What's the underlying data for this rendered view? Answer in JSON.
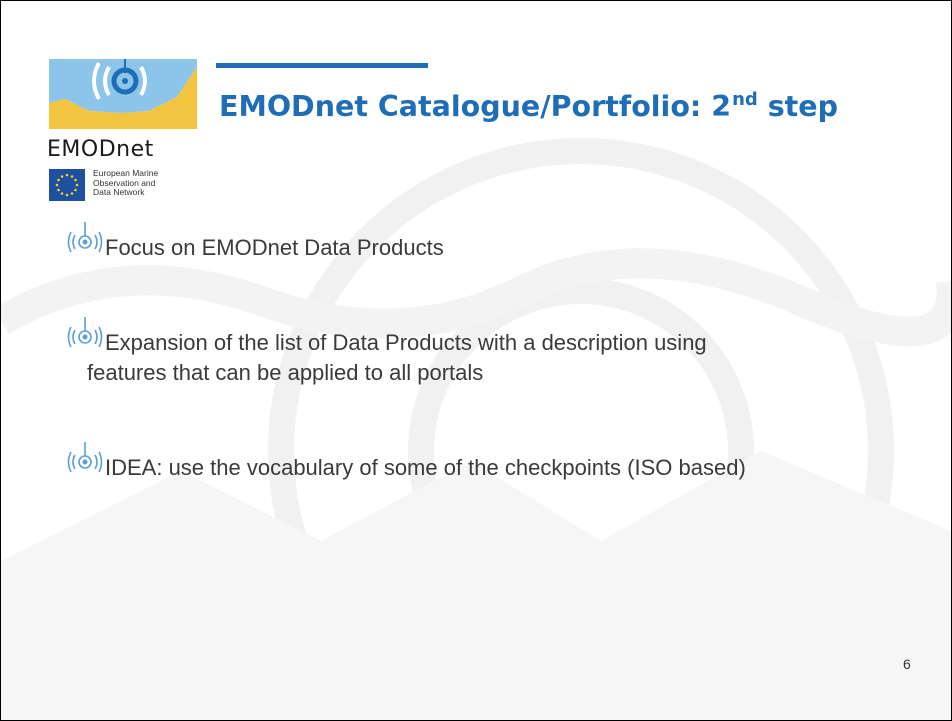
{
  "logo": {
    "wordmark": "EMODnet",
    "subtitle_lines": [
      "European Marine",
      "Observation and",
      "Data Network"
    ]
  },
  "slide": {
    "title_main": "EMODnet Catalogue/Portfolio: 2",
    "title_sup": "nd",
    "title_end": " step",
    "bullets": [
      {
        "line1": "Focus on EMODnet Data Products",
        "line2": ""
      },
      {
        "line1": "Expansion of the list of Data Products with a description using",
        "line2": "features that can be applied to all portals"
      },
      {
        "line1": "IDEA: use the vocabulary of some of the checkpoints (ISO based)",
        "line2": ""
      }
    ],
    "page_number": "6"
  },
  "colors": {
    "accent": "#1f6db6",
    "logo_yellow": "#f3c43f",
    "logo_lightblue": "#8cc4ea",
    "bullet_icon": "#5aa0d6"
  },
  "icons": {
    "bullet": "signal-wave-icon",
    "flag": "eu-flag-icon"
  }
}
